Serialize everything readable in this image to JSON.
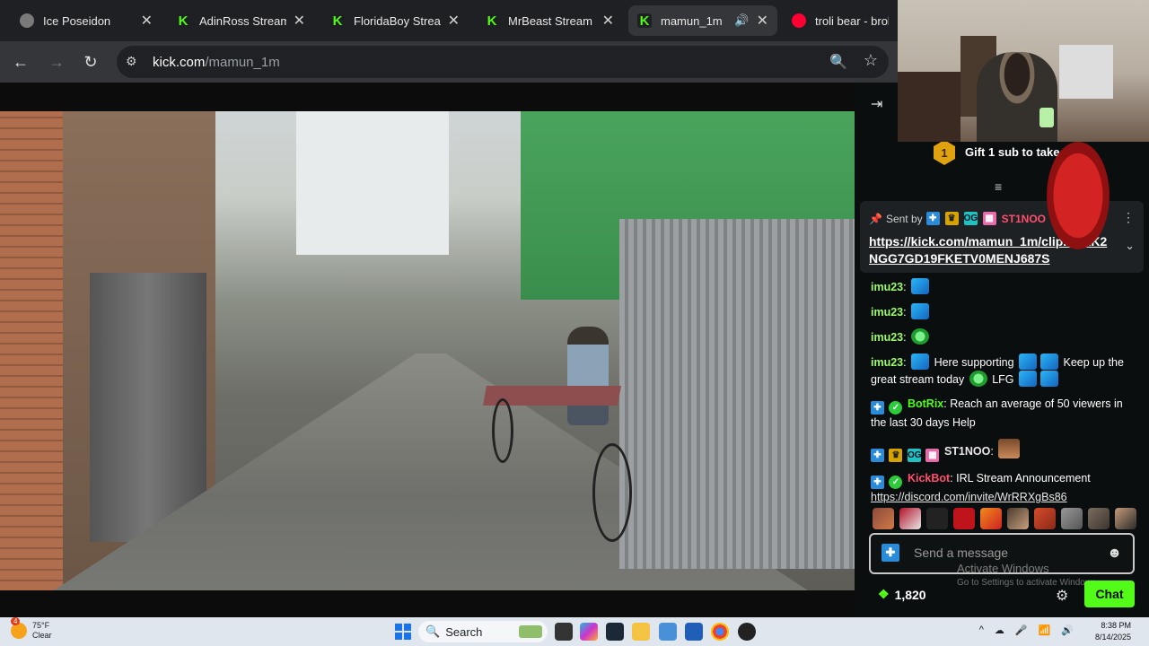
{
  "browser": {
    "tabs": [
      {
        "title": "Ice Poseidon",
        "icon": "globe-icon"
      },
      {
        "title": "AdinRoss Stream",
        "icon": "kick-icon"
      },
      {
        "title": "FloridaBoy Stream",
        "icon": "kick-icon"
      },
      {
        "title": "MrBeast Stream",
        "icon": "kick-icon"
      },
      {
        "title": "mamun_1m",
        "icon": "kick-icon",
        "active": true
      },
      {
        "title": "troli bear - broke",
        "icon": "youtube-icon"
      }
    ],
    "url_host": "kick.com",
    "url_path": "/mamun_1m"
  },
  "chat": {
    "gift_text": "Gift 1 sub to take 1s",
    "gift_rank": "1",
    "pinned": {
      "sent_by_label": "Sent by",
      "sender": "ST1NOO",
      "link": "https://kick.com/mamun_1m/clip...0 1K2NGG7GD19FKETV0MENJ687S"
    },
    "messages": [
      {
        "user": "imu23",
        "text": ""
      },
      {
        "user": "imu23",
        "text": ""
      },
      {
        "user": "imu23",
        "text": ""
      },
      {
        "user": "imu23",
        "text_a": "Here supporting",
        "text_b": "Keep up the great stream today",
        "text_c": "LFG"
      },
      {
        "user": "BotRix",
        "text": "Reach an average of 50 viewers in the last 30 days Help"
      },
      {
        "user": "ST1NOO",
        "text": ""
      },
      {
        "user": "KickBot",
        "text": "IRL Stream Announcement",
        "link": "https://discord.com/invite/WrRRXgBs86"
      }
    ],
    "input_placeholder": "Send a message",
    "points": "1,820",
    "chat_button": "Chat",
    "activate_title": "Activate Windows",
    "activate_sub": "Go to Settings to activate Windows."
  },
  "taskbar": {
    "temp": "75°F",
    "condition": "Clear",
    "weather_badge": "4",
    "search": "Search",
    "time": "8:38 PM",
    "date": "8/14/2025"
  },
  "colors": {
    "kick_green": "#53fc18",
    "chat_bg": "#0b0e0f",
    "accent_blue": "#2a8bd8"
  }
}
